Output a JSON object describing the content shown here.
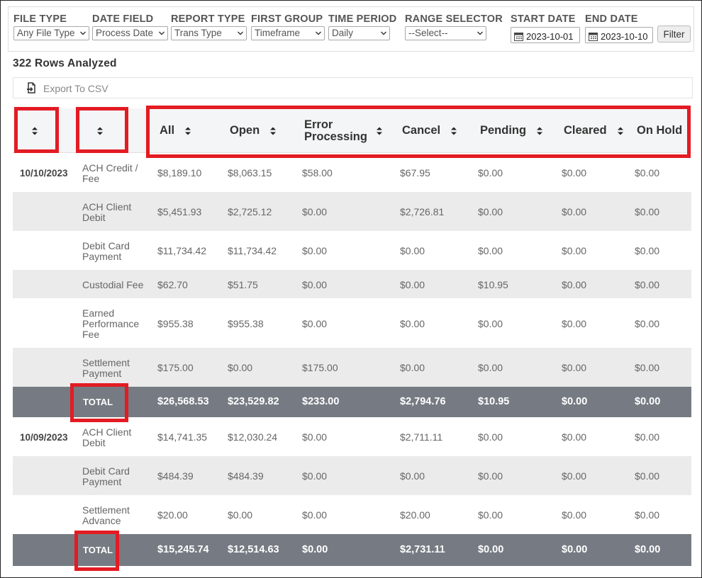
{
  "filters": [
    {
      "label": "FILE TYPE",
      "value": "Any File Type"
    },
    {
      "label": "DATE FIELD",
      "value": "Process Date"
    },
    {
      "label": "REPORT TYPE",
      "value": "Trans Type"
    },
    {
      "label": "FIRST GROUP",
      "value": "Timeframe"
    },
    {
      "label": "TIME PERIOD",
      "value": "Daily"
    },
    {
      "label": "RANGE SELECTOR",
      "value": "--Select--"
    }
  ],
  "start_date": {
    "label": "START DATE",
    "value": "2023-10-01",
    "icon": "calendar-icon"
  },
  "end_date": {
    "label": "END DATE",
    "value": "2023-10-10",
    "icon": "calendar-icon"
  },
  "filter_button": "Filter",
  "rows_analyzed": "322 Rows Analyzed",
  "export_label": "Export To CSV",
  "columns": [
    "All",
    "Open",
    "Error\nProcessing",
    "Cancel",
    "Pending",
    "Cleared",
    "On Hold"
  ],
  "groups": [
    {
      "date": "10/10/2023",
      "rows": [
        {
          "type": "ACH Credit / Fee",
          "values": [
            "$8,189.10",
            "$8,063.15",
            "$58.00",
            "$67.95",
            "$0.00",
            "$0.00",
            "$0.00"
          ]
        },
        {
          "type": "ACH Client Debit",
          "values": [
            "$5,451.93",
            "$2,725.12",
            "$0.00",
            "$2,726.81",
            "$0.00",
            "$0.00",
            "$0.00"
          ]
        },
        {
          "type": "Debit Card Payment",
          "values": [
            "$11,734.42",
            "$11,734.42",
            "$0.00",
            "$0.00",
            "$0.00",
            "$0.00",
            "$0.00"
          ]
        },
        {
          "type": "Custodial Fee",
          "values": [
            "$62.70",
            "$51.75",
            "$0.00",
            "$0.00",
            "$10.95",
            "$0.00",
            "$0.00"
          ]
        },
        {
          "type": "Earned Performance Fee",
          "values": [
            "$955.38",
            "$955.38",
            "$0.00",
            "$0.00",
            "$0.00",
            "$0.00",
            "$0.00"
          ]
        },
        {
          "type": "Settlement Payment",
          "values": [
            "$175.00",
            "$0.00",
            "$175.00",
            "$0.00",
            "$0.00",
            "$0.00",
            "$0.00"
          ]
        }
      ],
      "total": {
        "label": "TOTAL",
        "values": [
          "$26,568.53",
          "$23,529.82",
          "$233.00",
          "$2,794.76",
          "$10.95",
          "$0.00",
          "$0.00"
        ]
      }
    },
    {
      "date": "10/09/2023",
      "rows": [
        {
          "type": "ACH Client Debit",
          "values": [
            "$14,741.35",
            "$12,030.24",
            "$0.00",
            "$2,711.11",
            "$0.00",
            "$0.00",
            "$0.00"
          ]
        },
        {
          "type": "Debit Card Payment",
          "values": [
            "$484.39",
            "$484.39",
            "$0.00",
            "$0.00",
            "$0.00",
            "$0.00",
            "$0.00"
          ]
        },
        {
          "type": "Settlement Advance",
          "values": [
            "$20.00",
            "$0.00",
            "$0.00",
            "$20.00",
            "$0.00",
            "$0.00",
            "$0.00"
          ]
        }
      ],
      "total": {
        "label": "TOTAL",
        "values": [
          "$15,245.74",
          "$12,514.63",
          "$0.00",
          "$2,731.11",
          "$0.00",
          "$0.00",
          "$0.00"
        ]
      }
    }
  ],
  "colors": {
    "highlight": "#e31b23",
    "total_row": "#767b83",
    "alt_row": "#ebebeb",
    "header": "#f4f5f6"
  }
}
